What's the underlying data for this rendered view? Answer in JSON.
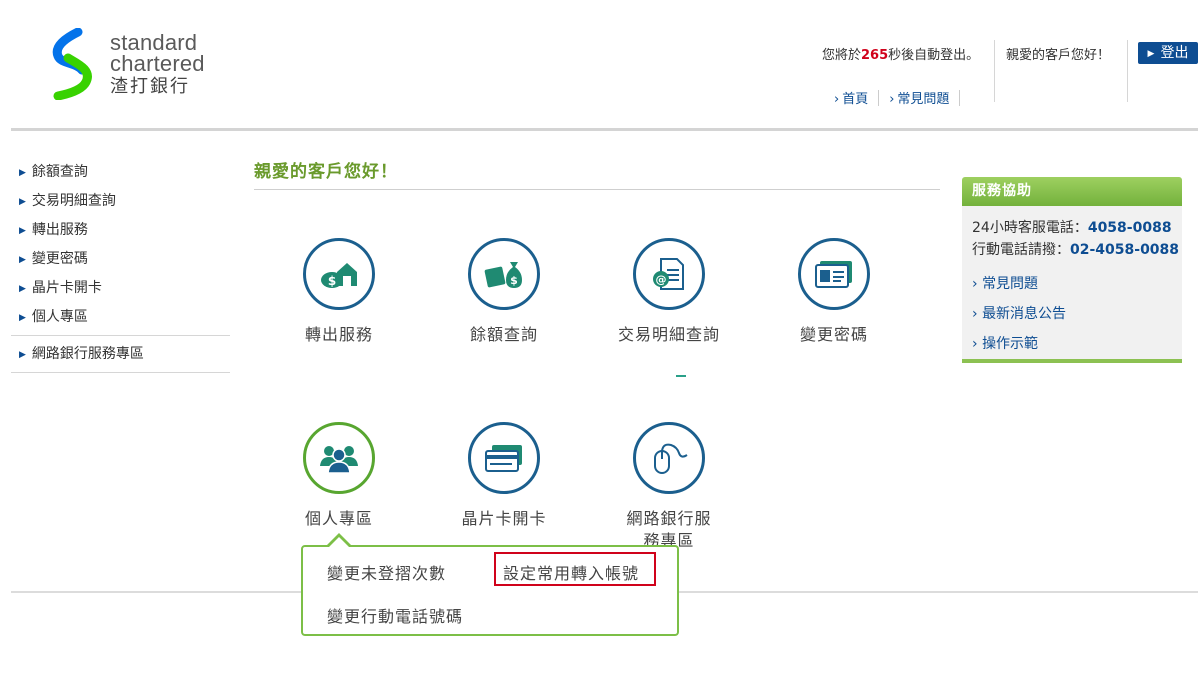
{
  "brand": {
    "line1": "standard",
    "line2": "chartered",
    "zh": "渣打銀行"
  },
  "header": {
    "autologout_pre": "您將於",
    "autologout_seconds": "265",
    "autologout_post": "秒後自動登出。",
    "greeting": "親愛的客戶您好！",
    "logout_label": "登出",
    "links": [
      {
        "label": "首頁"
      },
      {
        "label": "常見問題"
      }
    ]
  },
  "sidebar": {
    "items": [
      {
        "label": "餘額查詢"
      },
      {
        "label": "交易明細查詢"
      },
      {
        "label": "轉出服務"
      },
      {
        "label": "變更密碼"
      },
      {
        "label": "晶片卡開卡"
      },
      {
        "label": "個人專區"
      }
    ],
    "extra": {
      "label": "網路銀行服務專區"
    }
  },
  "main": {
    "title": "親愛的客戶您好！",
    "services": [
      {
        "label": "轉出服務",
        "icon": "money-house-icon"
      },
      {
        "label": "餘額查詢",
        "icon": "money-bag-icon"
      },
      {
        "label": "交易明細查詢",
        "icon": "document-at-icon"
      },
      {
        "label": "變更密碼",
        "icon": "id-card-icon"
      },
      {
        "label": "個人專區",
        "icon": "people-group-icon"
      },
      {
        "label": "晶片卡開卡",
        "icon": "chip-card-icon"
      },
      {
        "label": "網路銀行服務專區",
        "icon": "mouse-icon"
      }
    ],
    "popover": {
      "options": [
        {
          "label": "變更未登摺次數"
        },
        {
          "label": "設定常用轉入帳號"
        },
        {
          "label": "變更行動電話號碼"
        }
      ]
    }
  },
  "help": {
    "title": "服務協助",
    "hotline_label": "24小時客服電話：",
    "hotline": "4058-0088",
    "mobile_label": "行動電話請撥：",
    "mobile": "02-4058-0088",
    "links": [
      {
        "label": "常見問題"
      },
      {
        "label": "最新消息公告"
      },
      {
        "label": "操作示範"
      }
    ]
  },
  "colors": {
    "accent_blue": "#0e4d92",
    "accent_green": "#6a9a2c",
    "alert_red": "#d0021b"
  }
}
